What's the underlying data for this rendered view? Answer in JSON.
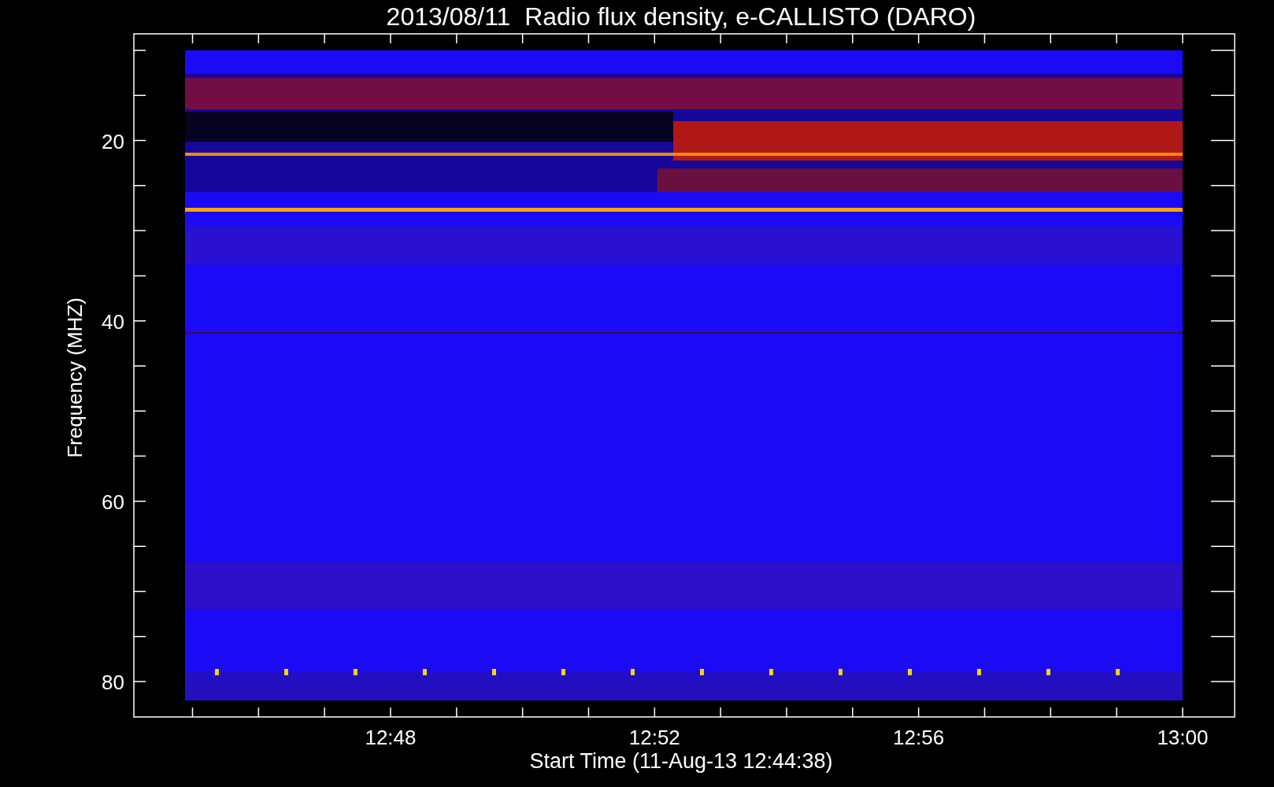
{
  "title": "2013/08/11  Radio flux density, e-CALLISTO (DARO)",
  "y_axis": {
    "label": "Frequency (MHZ)",
    "ticks": [
      "20",
      "40",
      "60",
      "80"
    ]
  },
  "x_axis": {
    "label": "Start Time (11-Aug-13 12:44:38)",
    "ticks": [
      "12:48",
      "12:52",
      "12:56",
      "13:00"
    ]
  }
}
